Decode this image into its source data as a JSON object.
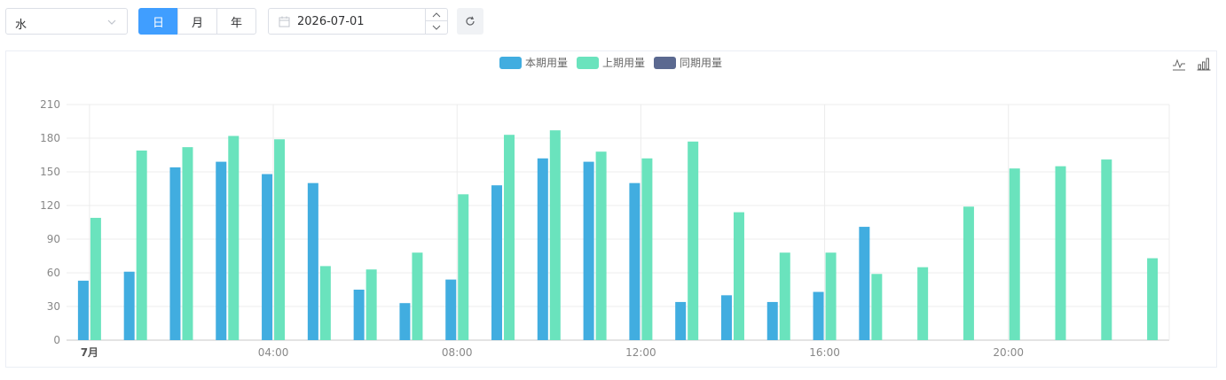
{
  "controls": {
    "energy_type": "水",
    "period_tabs": [
      {
        "label": "日",
        "active": true
      },
      {
        "label": "月",
        "active": false
      },
      {
        "label": "年",
        "active": false
      }
    ],
    "date_value": "2026-07-01"
  },
  "colors": {
    "primary": "#409eff",
    "current": "#41ade0",
    "previous": "#6ae3bd",
    "same_period": "#5b6990"
  },
  "chart_data": {
    "type": "bar",
    "legend": [
      "本期用量",
      "上期用量",
      "同期用量"
    ],
    "legend_position": "top-center",
    "x": [
      "00:00",
      "01:00",
      "02:00",
      "03:00",
      "04:00",
      "05:00",
      "06:00",
      "07:00",
      "08:00",
      "09:00",
      "10:00",
      "11:00",
      "12:00",
      "13:00",
      "14:00",
      "15:00",
      "16:00",
      "17:00",
      "18:00",
      "19:00",
      "20:00",
      "21:00",
      "22:00",
      "23:00"
    ],
    "x_tick_labels": [
      "7月",
      "04:00",
      "08:00",
      "12:00",
      "16:00",
      "20:00"
    ],
    "ylim": [
      0,
      210
    ],
    "y_ticks": [
      0,
      30,
      60,
      90,
      120,
      150,
      180,
      210
    ],
    "grid": true,
    "series": [
      {
        "name": "本期用量",
        "values": [
          53,
          61,
          154,
          159,
          148,
          140,
          45,
          33,
          54,
          138,
          162,
          159,
          140,
          34,
          40,
          34,
          43,
          101,
          null,
          null,
          null,
          null,
          null,
          null
        ]
      },
      {
        "name": "上期用量",
        "values": [
          109,
          169,
          172,
          182,
          179,
          66,
          63,
          78,
          130,
          183,
          187,
          168,
          162,
          177,
          114,
          78,
          78,
          59,
          65,
          119,
          153,
          155,
          161,
          73
        ]
      },
      {
        "name": "同期用量",
        "values": []
      }
    ]
  }
}
